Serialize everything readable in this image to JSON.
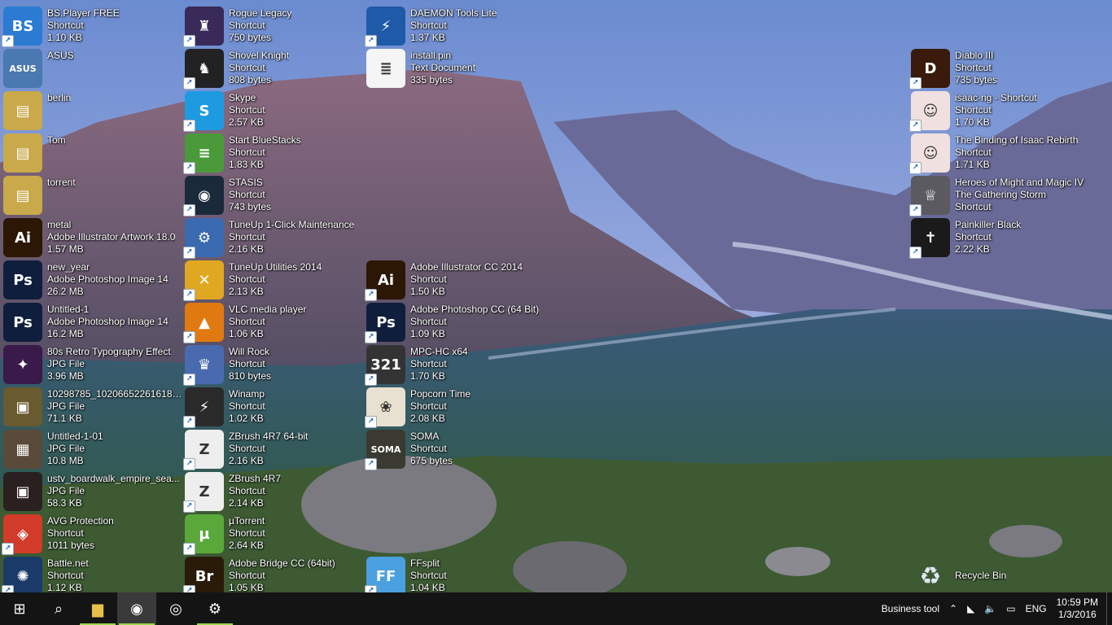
{
  "desktop": {
    "icons": [
      {
        "name": "BS.Player FREE",
        "type": "Shortcut",
        "size": "1.10 KB",
        "color": "#2a7bd1",
        "glyph": "BS"
      },
      {
        "name": "ASUS",
        "type": "",
        "size": "",
        "color": "#4a78b0",
        "glyph": "ASUS"
      },
      {
        "name": "berlin",
        "type": "",
        "size": "",
        "color": "#c9a94a",
        "glyph": "▤"
      },
      {
        "name": "Tom",
        "type": "",
        "size": "",
        "color": "#c9a94a",
        "glyph": "▤"
      },
      {
        "name": "torrent",
        "type": "",
        "size": "",
        "color": "#c9a94a",
        "glyph": "▤"
      },
      {
        "name": "metal",
        "type": "Adobe Illustrator Artwork 18.0",
        "size": "1.57 MB",
        "color": "#2b1704",
        "glyph": "Ai"
      },
      {
        "name": "new_year",
        "type": "Adobe Photoshop Image 14",
        "size": "26.2 MB",
        "color": "#0f1e3c",
        "glyph": "Ps"
      },
      {
        "name": "Untitled-1",
        "type": "Adobe Photoshop Image 14",
        "size": "16.2 MB",
        "color": "#0f1e3c",
        "glyph": "Ps"
      },
      {
        "name": "80s Retro Typography Effect",
        "type": "JPG File",
        "size": "3.96 MB",
        "color": "#3a1a4a",
        "glyph": "✦"
      },
      {
        "name": "10298785_1020665226161870...",
        "type": "JPG File",
        "size": "71.1 KB",
        "color": "#6a5a30",
        "glyph": "▣"
      },
      {
        "name": "Untitled-1-01",
        "type": "JPG File",
        "size": "10.8 MB",
        "color": "#5a4a3a",
        "glyph": "▦"
      },
      {
        "name": "ustv_boardwalk_empire_sea...",
        "type": "JPG File",
        "size": "58.3 KB",
        "color": "#2a2020",
        "glyph": "▣"
      },
      {
        "name": "AVG Protection",
        "type": "Shortcut",
        "size": "1011 bytes",
        "color": "#d23a2a",
        "glyph": "◈"
      },
      {
        "name": "Battle.net",
        "type": "Shortcut",
        "size": "1.12 KB",
        "color": "#1a3a6a",
        "glyph": "✺"
      },
      {
        "name": "Rogue Legacy",
        "type": "Shortcut",
        "size": "750 bytes",
        "color": "#3a2a5a",
        "glyph": "♜"
      },
      {
        "name": "Shovel Knight",
        "type": "Shortcut",
        "size": "808 bytes",
        "color": "#222",
        "glyph": "♞"
      },
      {
        "name": "Skype",
        "type": "Shortcut",
        "size": "2.57 KB",
        "color": "#1e9be0",
        "glyph": "S"
      },
      {
        "name": "Start BlueStacks",
        "type": "Shortcut",
        "size": "1.83 KB",
        "color": "#4a9a3a",
        "glyph": "≡"
      },
      {
        "name": "STASIS",
        "type": "Shortcut",
        "size": "743 bytes",
        "color": "#1a2a3a",
        "glyph": "◉"
      },
      {
        "name": "TuneUp 1-Click Maintenance",
        "type": "Shortcut",
        "size": "2.16 KB",
        "color": "#3a6ab0",
        "glyph": "⚙"
      },
      {
        "name": "TuneUp Utilities 2014",
        "type": "Shortcut",
        "size": "2.13 KB",
        "color": "#e0a820",
        "glyph": "✕"
      },
      {
        "name": "VLC media player",
        "type": "Shortcut",
        "size": "1.06 KB",
        "color": "#e07a10",
        "glyph": "▲"
      },
      {
        "name": "Will Rock",
        "type": "Shortcut",
        "size": "810 bytes",
        "color": "#4a6ab0",
        "glyph": "♛"
      },
      {
        "name": "Winamp",
        "type": "Shortcut",
        "size": "1.02 KB",
        "color": "#2a2a2a",
        "glyph": "⚡"
      },
      {
        "name": "ZBrush 4R7 64-bit",
        "type": "Shortcut",
        "size": "2.16 KB",
        "color": "#eeeeee",
        "glyph": "Z"
      },
      {
        "name": "ZBrush 4R7",
        "type": "Shortcut",
        "size": "2.14 KB",
        "color": "#eeeeee",
        "glyph": "Z"
      },
      {
        "name": "µTorrent",
        "type": "Shortcut",
        "size": "2.64 KB",
        "color": "#5aa83a",
        "glyph": "µ"
      },
      {
        "name": "Adobe Bridge CC (64bit)",
        "type": "Shortcut",
        "size": "1.05 KB",
        "color": "#2a1a08",
        "glyph": "Br"
      },
      {
        "name": "DAEMON Tools Lite",
        "type": "Shortcut",
        "size": "1.37 KB",
        "color": "#1e5aa8",
        "glyph": "⚡"
      },
      {
        "name": "install.pin",
        "type": "Text Document",
        "size": "335 bytes",
        "color": "#f5f5f5",
        "glyph": "≣"
      },
      {
        "name": "Adobe Illustrator CC 2014",
        "type": "Shortcut",
        "size": "1.50 KB",
        "color": "#2b1704",
        "glyph": "Ai"
      },
      {
        "name": "Adobe Photoshop CC (64 Bit)",
        "type": "Shortcut",
        "size": "1.09 KB",
        "color": "#0f1e3c",
        "glyph": "Ps"
      },
      {
        "name": "MPC-HC x64",
        "type": "Shortcut",
        "size": "1.70 KB",
        "color": "#333",
        "glyph": "321"
      },
      {
        "name": "Popcorn Time",
        "type": "Shortcut",
        "size": "2.08 KB",
        "color": "#e8e0d0",
        "glyph": "❀"
      },
      {
        "name": "SOMA",
        "type": "Shortcut",
        "size": "675 bytes",
        "color": "#3a3a30",
        "glyph": "SOMA"
      },
      {
        "name": "FFsplit",
        "type": "Shortcut",
        "size": "1.04 KB",
        "color": "#4aa0e0",
        "glyph": "FF"
      },
      {
        "name": "Diablo III",
        "type": "Shortcut",
        "size": "735 bytes",
        "color": "#3a1a0a",
        "glyph": "D"
      },
      {
        "name": "isaac-ng - Shortcut",
        "type": "Shortcut",
        "size": "1.70 KB",
        "color": "#f0e0e0",
        "glyph": "☺"
      },
      {
        "name": "The Binding of Isaac Rebirth",
        "type": "Shortcut",
        "size": "1.71 KB",
        "color": "#f0e0e0",
        "glyph": "☺"
      },
      {
        "name": "Heroes of Might and Magic IV The Gathering Storm",
        "type": "Shortcut",
        "size": "",
        "color": "#5a5a60",
        "glyph": "♕"
      },
      {
        "name": "Painkiller Black",
        "type": "Shortcut",
        "size": "2.22 KB",
        "color": "#1a1a1a",
        "glyph": "✝"
      },
      {
        "name": "Recycle Bin",
        "type": "",
        "size": "",
        "color": "transparent",
        "glyph": "♻"
      }
    ]
  },
  "taskbar": {
    "buttons": [
      {
        "name": "start-button",
        "icon": "windows-logo-icon",
        "glyph": "⊞"
      },
      {
        "name": "search-button",
        "icon": "search-icon",
        "glyph": "⌕"
      },
      {
        "name": "file-explorer-button",
        "icon": "folder-icon",
        "glyph": "▆"
      },
      {
        "name": "chrome-button",
        "icon": "chrome-icon",
        "glyph": "◉"
      },
      {
        "name": "media-button",
        "icon": "disc-icon",
        "glyph": "◎"
      },
      {
        "name": "settings-button",
        "icon": "gear-icon",
        "glyph": "⚙"
      }
    ],
    "tray": {
      "toolbar_label": "Business tool",
      "chevron": "⌃",
      "network": "◣",
      "volume": "🔈",
      "notifications": "▭",
      "language": "ENG",
      "time": "10:59 PM",
      "date": "1/3/2016"
    }
  }
}
